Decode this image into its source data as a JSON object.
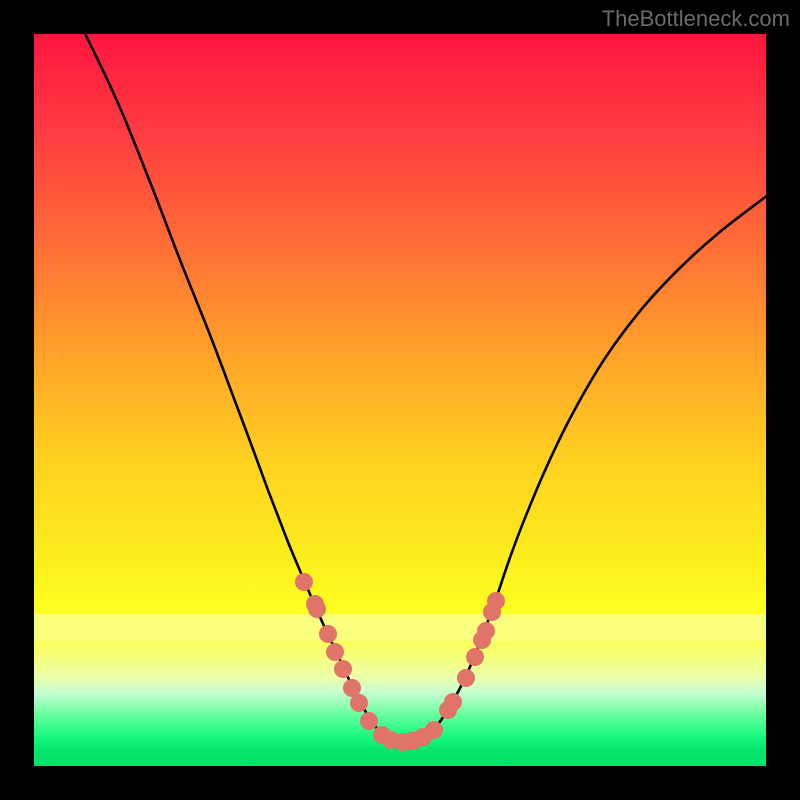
{
  "watermark": "TheBottleneck.com",
  "chart_data": {
    "type": "line",
    "title": "",
    "xlabel": "",
    "ylabel": "",
    "xlim": [
      0,
      100
    ],
    "ylim": [
      0,
      100
    ],
    "note": "Axes are not labeled in the source image; x and y treated as 0–100 percent of plot area measured from top-left.",
    "gradient_bands_pct": {
      "main_start": 0,
      "pale_yellow_start": 79.2,
      "pale_yellow_end": 82.9,
      "green_end": 100
    },
    "series": [
      {
        "name": "curve",
        "stroke": "#000000",
        "path_xy_pct": [
          [
            7.0,
            0.0
          ],
          [
            11.5,
            9.5
          ],
          [
            16.0,
            20.6
          ],
          [
            20.0,
            31.0
          ],
          [
            24.0,
            41.0
          ],
          [
            27.4,
            50.0
          ],
          [
            29.5,
            55.6
          ],
          [
            32.0,
            62.4
          ],
          [
            34.5,
            68.9
          ],
          [
            36.2,
            73.0
          ],
          [
            38.0,
            77.2
          ],
          [
            39.5,
            80.6
          ],
          [
            41.0,
            83.8
          ],
          [
            42.4,
            86.8
          ],
          [
            43.6,
            89.4
          ],
          [
            44.8,
            91.7
          ],
          [
            46.0,
            93.7
          ],
          [
            47.3,
            95.4
          ],
          [
            48.7,
            96.4
          ],
          [
            50.3,
            96.7
          ],
          [
            52.0,
            96.5
          ],
          [
            53.7,
            95.7
          ],
          [
            55.0,
            94.5
          ],
          [
            56.1,
            93.0
          ],
          [
            57.7,
            90.3
          ],
          [
            59.0,
            87.7
          ],
          [
            60.3,
            84.7
          ],
          [
            61.5,
            81.6
          ],
          [
            63.0,
            77.5
          ],
          [
            65.0,
            71.6
          ],
          [
            67.0,
            66.3
          ],
          [
            70.0,
            59.2
          ],
          [
            73.5,
            52.0
          ],
          [
            78.0,
            44.3
          ],
          [
            83.0,
            37.6
          ],
          [
            88.0,
            32.2
          ],
          [
            93.5,
            27.2
          ],
          [
            100.0,
            22.2
          ]
        ]
      }
    ],
    "markers_xy_pct": [
      [
        36.9,
        74.8
      ],
      [
        38.4,
        77.9
      ],
      [
        38.7,
        78.6
      ],
      [
        40.1,
        82.0
      ],
      [
        41.1,
        84.4
      ],
      [
        42.2,
        86.8
      ],
      [
        43.4,
        89.4
      ],
      [
        44.4,
        91.4
      ],
      [
        45.7,
        93.8
      ],
      [
        47.5,
        95.8
      ],
      [
        48.8,
        96.5
      ],
      [
        50.4,
        96.7
      ],
      [
        51.8,
        96.6
      ],
      [
        53.2,
        96.1
      ],
      [
        54.6,
        95.1
      ],
      [
        56.6,
        92.4
      ],
      [
        57.3,
        91.2
      ],
      [
        59.0,
        88.0
      ],
      [
        60.3,
        85.1
      ],
      [
        61.2,
        82.8
      ],
      [
        61.7,
        81.5
      ],
      [
        62.6,
        78.9
      ],
      [
        63.1,
        77.5
      ]
    ],
    "marker_color": "#e07468"
  }
}
